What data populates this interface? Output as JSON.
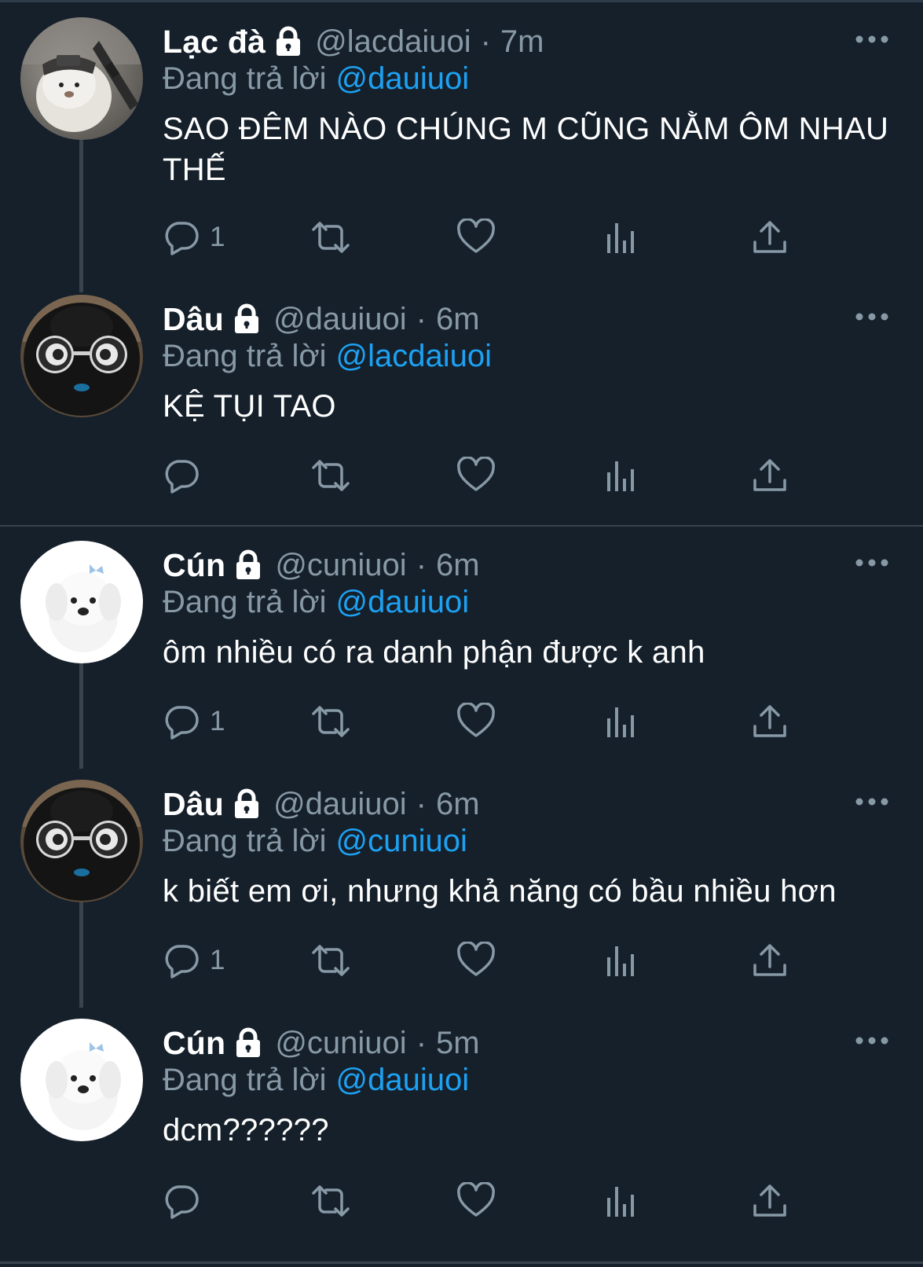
{
  "reply_prefix": "Đang trả lời",
  "time_separator": "·",
  "colors": {
    "background": "#15202b",
    "text_primary": "#ffffff",
    "text_secondary": "#8899a6",
    "accent": "#1da1f2",
    "divider": "#38444d"
  },
  "tweets": [
    {
      "name": "Lạc đà",
      "handle": "@lacdaiuoi",
      "time": "7m",
      "reply_to": "@dauiuoi",
      "text": "SAO ĐÊM NÀO CHÚNG M CŨNG NẰM ÔM NHAU THẾ",
      "reply_count": "1",
      "avatar_icon": "llama-avatar"
    },
    {
      "name": "Dâu",
      "handle": "@dauiuoi",
      "time": "6m",
      "reply_to": "@lacdaiuoi",
      "text": "KỆ TỤI TAO",
      "reply_count": "",
      "avatar_icon": "plush-glasses-avatar"
    },
    {
      "name": "Cún",
      "handle": "@cuniuoi",
      "time": "6m",
      "reply_to": "@dauiuoi",
      "text": "ôm nhiều có ra danh phận được k anh",
      "reply_count": "1",
      "avatar_icon": "white-puppy-avatar"
    },
    {
      "name": "Dâu",
      "handle": "@dauiuoi",
      "time": "6m",
      "reply_to": "@cuniuoi",
      "text": "k biết em ơi, nhưng khả năng có bầu nhiều hơn",
      "reply_count": "1",
      "avatar_icon": "plush-glasses-avatar"
    },
    {
      "name": "Cún",
      "handle": "@cuniuoi",
      "time": "5m",
      "reply_to": "@dauiuoi",
      "text": "dcm??????",
      "reply_count": "",
      "avatar_icon": "white-puppy-avatar"
    }
  ]
}
